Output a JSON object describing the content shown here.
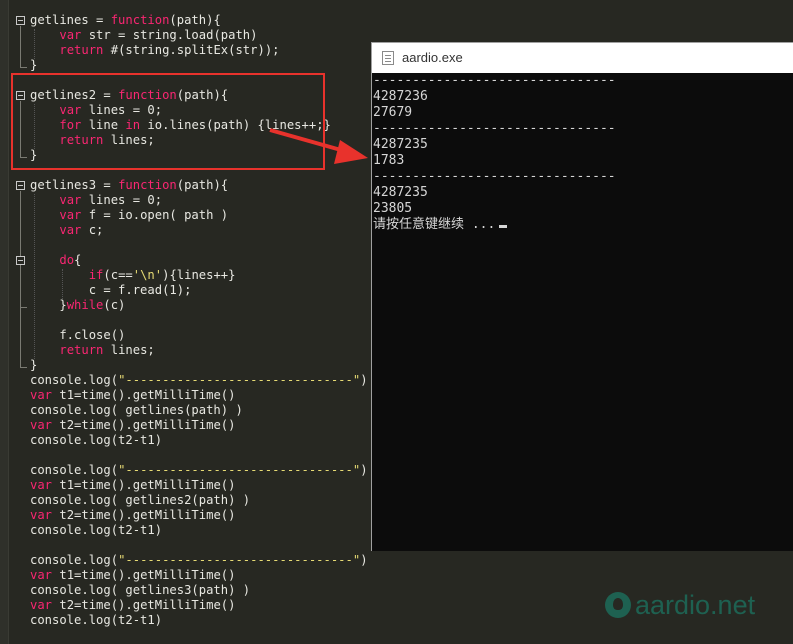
{
  "code": {
    "lines": [
      [
        {
          "t": "getlines = "
        },
        {
          "t": "function",
          "c": "kw"
        },
        {
          "t": "(path){"
        }
      ],
      [
        {
          "t": "    "
        },
        {
          "t": "var",
          "c": "kw"
        },
        {
          "t": " str = string.load(path)"
        }
      ],
      [
        {
          "t": "    "
        },
        {
          "t": "return",
          "c": "kw"
        },
        {
          "t": " #(string.splitEx(str));"
        }
      ],
      [
        {
          "t": "}"
        }
      ],
      [
        {
          "t": ""
        }
      ],
      [
        {
          "t": "getlines2 = "
        },
        {
          "t": "function",
          "c": "kw"
        },
        {
          "t": "(path){"
        }
      ],
      [
        {
          "t": "    "
        },
        {
          "t": "var",
          "c": "kw"
        },
        {
          "t": " lines = 0;"
        }
      ],
      [
        {
          "t": "    "
        },
        {
          "t": "for",
          "c": "kw"
        },
        {
          "t": " line "
        },
        {
          "t": "in",
          "c": "kw"
        },
        {
          "t": " io.lines(path) {lines++;}"
        }
      ],
      [
        {
          "t": "    "
        },
        {
          "t": "return",
          "c": "kw"
        },
        {
          "t": " lines;"
        }
      ],
      [
        {
          "t": "}"
        }
      ],
      [
        {
          "t": ""
        }
      ],
      [
        {
          "t": "getlines3 = "
        },
        {
          "t": "function",
          "c": "kw"
        },
        {
          "t": "(path){"
        }
      ],
      [
        {
          "t": "    "
        },
        {
          "t": "var",
          "c": "kw"
        },
        {
          "t": " lines = 0;"
        }
      ],
      [
        {
          "t": "    "
        },
        {
          "t": "var",
          "c": "kw"
        },
        {
          "t": " f = io.open( path )"
        }
      ],
      [
        {
          "t": "    "
        },
        {
          "t": "var",
          "c": "kw"
        },
        {
          "t": " c;"
        }
      ],
      [
        {
          "t": ""
        }
      ],
      [
        {
          "t": "    "
        },
        {
          "t": "do",
          "c": "kw"
        },
        {
          "t": "{"
        }
      ],
      [
        {
          "t": "        "
        },
        {
          "t": "if",
          "c": "kw"
        },
        {
          "t": "(c=="
        },
        {
          "t": "'\\n'",
          "c": "str"
        },
        {
          "t": "){lines++}"
        }
      ],
      [
        {
          "t": "        c = f.read(1);"
        }
      ],
      [
        {
          "t": "    }"
        },
        {
          "t": "while",
          "c": "kw"
        },
        {
          "t": "(c)"
        }
      ],
      [
        {
          "t": ""
        }
      ],
      [
        {
          "t": "    f.close()"
        }
      ],
      [
        {
          "t": "    "
        },
        {
          "t": "return",
          "c": "kw"
        },
        {
          "t": " lines;"
        }
      ],
      [
        {
          "t": "}"
        }
      ],
      [
        {
          "t": "console.log("
        },
        {
          "t": "\"-------------------------------\"",
          "c": "str"
        },
        {
          "t": ")"
        }
      ],
      [
        {
          "t": "var",
          "c": "kw"
        },
        {
          "t": " t1=time().getMilliTime()"
        }
      ],
      [
        {
          "t": "console.log( getlines(path) )"
        }
      ],
      [
        {
          "t": "var",
          "c": "kw"
        },
        {
          "t": " t2=time().getMilliTime()"
        }
      ],
      [
        {
          "t": "console.log(t2-t1)"
        }
      ],
      [
        {
          "t": ""
        }
      ],
      [
        {
          "t": "console.log("
        },
        {
          "t": "\"-------------------------------\"",
          "c": "str"
        },
        {
          "t": ")"
        }
      ],
      [
        {
          "t": "var",
          "c": "kw"
        },
        {
          "t": " t1=time().getMilliTime()"
        }
      ],
      [
        {
          "t": "console.log( getlines2(path) )"
        }
      ],
      [
        {
          "t": "var",
          "c": "kw"
        },
        {
          "t": " t2=time().getMilliTime()"
        }
      ],
      [
        {
          "t": "console.log(t2-t1)"
        }
      ],
      [
        {
          "t": ""
        }
      ],
      [
        {
          "t": "console.log("
        },
        {
          "t": "\"-------------------------------\"",
          "c": "str"
        },
        {
          "t": ")"
        }
      ],
      [
        {
          "t": "var",
          "c": "kw"
        },
        {
          "t": " t1=time().getMilliTime()"
        }
      ],
      [
        {
          "t": "console.log( getlines3(path) )"
        }
      ],
      [
        {
          "t": "var",
          "c": "kw"
        },
        {
          "t": " t2=time().getMilliTime()"
        }
      ],
      [
        {
          "t": "console.log(t2-t1)"
        }
      ]
    ]
  },
  "console_window": {
    "title": "aardio.exe",
    "output": [
      "-------------------------------",
      "4287236",
      "27679",
      "-------------------------------",
      "4287235",
      "1783",
      "-------------------------------",
      "4287235",
      "23805",
      "请按任意键继续 ..."
    ]
  },
  "watermark": {
    "text": "aardio.net",
    "icon": "github-icon"
  },
  "colors": {
    "editor_bg": "#272822",
    "keyword": "#f92672",
    "string": "#e6db74",
    "text": "#e8e8e2",
    "highlight_box": "#e8322c",
    "console_bg": "#0c0c0c"
  }
}
